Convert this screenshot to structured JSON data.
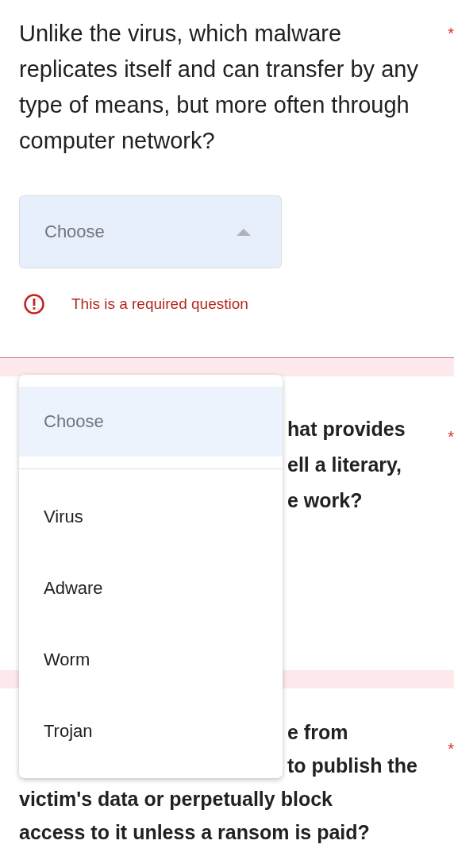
{
  "questions": [
    {
      "text": "Unlike the virus, which malware replicates itself and can transfer by any type of means, but more often through computer network?",
      "required_mark": "*",
      "select": {
        "placeholder": "Choose",
        "expanded": true
      },
      "error": "This is a required question"
    },
    {
      "lines": [
        {
          "text": "hat provides",
          "clipped": true
        },
        {
          "text": "ell a literary,",
          "clipped": true
        },
        {
          "text": "e work?",
          "clipped": true
        }
      ],
      "required_mark": "*"
    },
    {
      "lines": [
        {
          "text": "e from",
          "clipped": true
        },
        {
          "text": "to publish the",
          "clipped": true
        },
        {
          "text": "victim's data or perpetually block",
          "clipped": false
        },
        {
          "text": "access to it unless a ransom is paid?",
          "clipped": false
        }
      ],
      "required_mark": "*"
    }
  ],
  "menu": {
    "options": [
      {
        "label": "Choose",
        "selected": true
      },
      {
        "label": "Virus",
        "selected": false
      },
      {
        "label": "Adware",
        "selected": false
      },
      {
        "label": "Worm",
        "selected": false
      },
      {
        "label": "Trojan",
        "selected": false
      }
    ]
  }
}
